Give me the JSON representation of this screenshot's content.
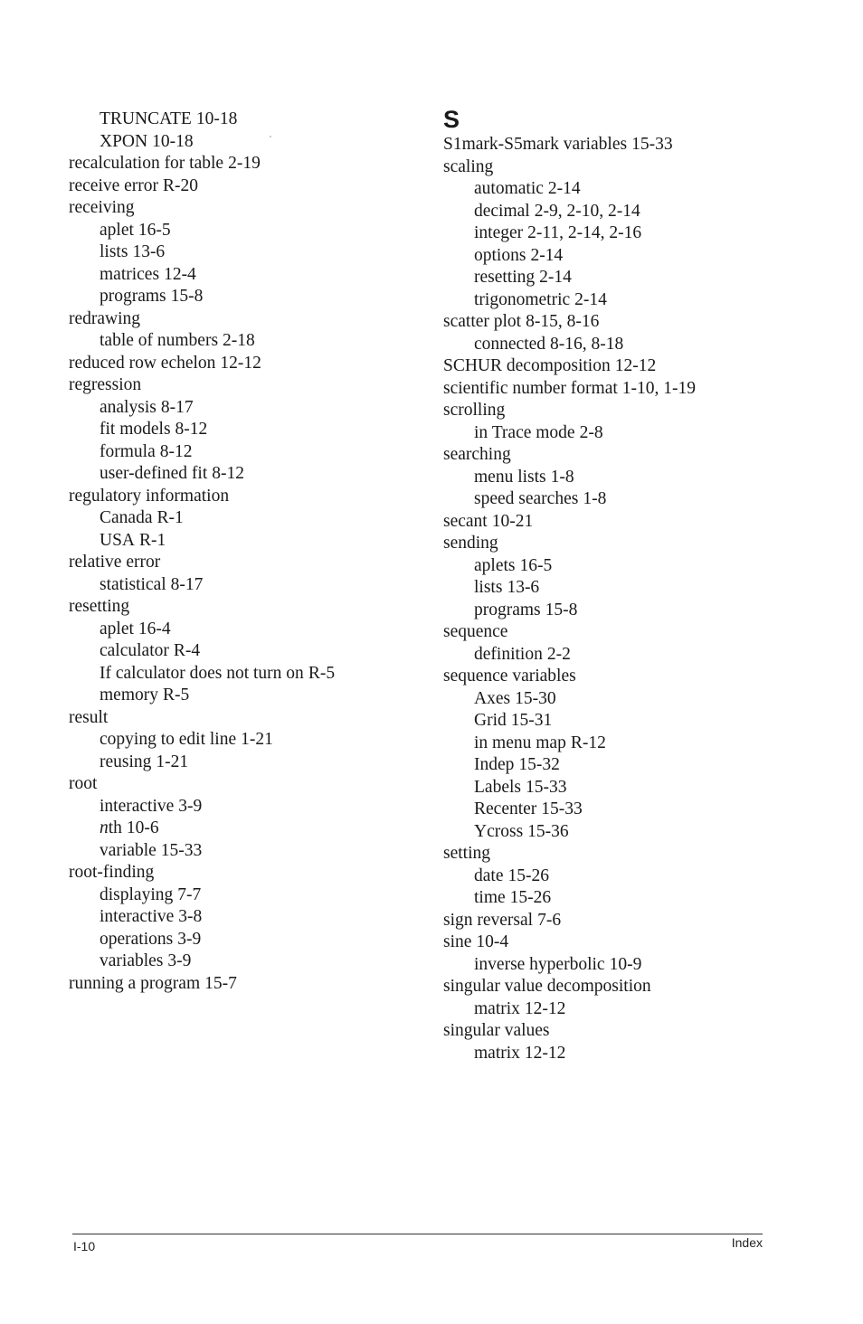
{
  "footer": {
    "page_number": "I-10",
    "section_name": "Index"
  },
  "left_column": {
    "entries": [
      {
        "level": "sub",
        "term": "TRUNCATE",
        "ref": "10-18"
      },
      {
        "level": "sub",
        "term": "XPON",
        "ref": "10-18"
      },
      {
        "level": "main",
        "term": "recalculation for table",
        "ref": "2-19"
      },
      {
        "level": "main",
        "term": "receive error",
        "ref": "R-20"
      },
      {
        "level": "main",
        "term": "receiving",
        "ref": ""
      },
      {
        "level": "sub",
        "term": "aplet",
        "ref": "16-5"
      },
      {
        "level": "sub",
        "term": "lists",
        "ref": "13-6"
      },
      {
        "level": "sub",
        "term": "matrices",
        "ref": "12-4"
      },
      {
        "level": "sub",
        "term": "programs",
        "ref": "15-8"
      },
      {
        "level": "main",
        "term": "redrawing",
        "ref": ""
      },
      {
        "level": "sub",
        "term": "table of numbers",
        "ref": "2-18"
      },
      {
        "level": "main",
        "term": "reduced row echelon",
        "ref": "12-12"
      },
      {
        "level": "main",
        "term": "regression",
        "ref": ""
      },
      {
        "level": "sub",
        "term": "analysis",
        "ref": "8-17"
      },
      {
        "level": "sub",
        "term": "fit models",
        "ref": "8-12"
      },
      {
        "level": "sub",
        "term": "formula",
        "ref": "8-12"
      },
      {
        "level": "sub",
        "term": "user-defined fit",
        "ref": "8-12"
      },
      {
        "level": "main",
        "term": "regulatory information",
        "ref": ""
      },
      {
        "level": "sub",
        "term": "Canada",
        "ref": "R-1"
      },
      {
        "level": "sub",
        "term": "USA",
        "ref": "R-1"
      },
      {
        "level": "main",
        "term": "relative error",
        "ref": ""
      },
      {
        "level": "sub",
        "term": "statistical",
        "ref": "8-17"
      },
      {
        "level": "main",
        "term": "resetting",
        "ref": ""
      },
      {
        "level": "sub",
        "term": "aplet",
        "ref": "16-4"
      },
      {
        "level": "sub",
        "term": "calculator",
        "ref": "R-4"
      },
      {
        "level": "sub",
        "term": "If calculator does not turn on",
        "ref": "R-5"
      },
      {
        "level": "sub",
        "term": "memory",
        "ref": "R-5"
      },
      {
        "level": "main",
        "term": "result",
        "ref": ""
      },
      {
        "level": "sub",
        "term": "copying to edit line",
        "ref": "1-21"
      },
      {
        "level": "sub",
        "term": "reusing",
        "ref": "1-21"
      },
      {
        "level": "main",
        "term": "root",
        "ref": ""
      },
      {
        "level": "sub",
        "term": "interactive",
        "ref": "3-9"
      },
      {
        "level": "sub",
        "term": "nth",
        "ref": "10-6",
        "italic_prefix": "n",
        "rest": "th"
      },
      {
        "level": "sub",
        "term": "variable",
        "ref": "15-33"
      },
      {
        "level": "main",
        "term": "root-finding",
        "ref": ""
      },
      {
        "level": "sub",
        "term": "displaying",
        "ref": "7-7"
      },
      {
        "level": "sub",
        "term": "interactive",
        "ref": "3-8"
      },
      {
        "level": "sub",
        "term": "operations",
        "ref": "3-9"
      },
      {
        "level": "sub",
        "term": "variables",
        "ref": "3-9"
      },
      {
        "level": "main",
        "term": "running a program",
        "ref": "15-7"
      }
    ]
  },
  "right_column": {
    "section_letter": "S",
    "entries": [
      {
        "level": "main",
        "term": "S1mark-S5mark variables",
        "ref": "15-33"
      },
      {
        "level": "main",
        "term": "scaling",
        "ref": ""
      },
      {
        "level": "sub",
        "term": "automatic",
        "ref": "2-14"
      },
      {
        "level": "sub",
        "term": "decimal",
        "ref": "2-9, 2-10, 2-14"
      },
      {
        "level": "sub",
        "term": "integer",
        "ref": "2-11, 2-14, 2-16"
      },
      {
        "level": "sub",
        "term": "options",
        "ref": "2-14"
      },
      {
        "level": "sub",
        "term": "resetting",
        "ref": "2-14"
      },
      {
        "level": "sub",
        "term": "trigonometric",
        "ref": "2-14"
      },
      {
        "level": "main",
        "term": "scatter plot",
        "ref": "8-15, 8-16"
      },
      {
        "level": "sub",
        "term": "connected",
        "ref": "8-16, 8-18"
      },
      {
        "level": "main",
        "term": "SCHUR decomposition",
        "ref": "12-12"
      },
      {
        "level": "main",
        "term": "scientific number format",
        "ref": "1-10, 1-19"
      },
      {
        "level": "main",
        "term": "scrolling",
        "ref": ""
      },
      {
        "level": "sub",
        "term": "in Trace mode",
        "ref": "2-8"
      },
      {
        "level": "main",
        "term": "searching",
        "ref": ""
      },
      {
        "level": "sub",
        "term": "menu lists",
        "ref": "1-8"
      },
      {
        "level": "sub",
        "term": "speed searches",
        "ref": "1-8"
      },
      {
        "level": "main",
        "term": "secant",
        "ref": "10-21"
      },
      {
        "level": "main",
        "term": "sending",
        "ref": ""
      },
      {
        "level": "sub",
        "term": "aplets",
        "ref": "16-5"
      },
      {
        "level": "sub",
        "term": "lists",
        "ref": "13-6"
      },
      {
        "level": "sub",
        "term": "programs",
        "ref": "15-8"
      },
      {
        "level": "main",
        "term": "sequence",
        "ref": ""
      },
      {
        "level": "sub",
        "term": "definition",
        "ref": "2-2"
      },
      {
        "level": "main",
        "term": "sequence variables",
        "ref": ""
      },
      {
        "level": "sub",
        "term": "Axes",
        "ref": "15-30"
      },
      {
        "level": "sub",
        "term": "Grid",
        "ref": "15-31"
      },
      {
        "level": "sub",
        "term": "in menu map",
        "ref": "R-12"
      },
      {
        "level": "sub",
        "term": "Indep",
        "ref": "15-32"
      },
      {
        "level": "sub",
        "term": "Labels",
        "ref": "15-33"
      },
      {
        "level": "sub",
        "term": "Recenter",
        "ref": "15-33"
      },
      {
        "level": "sub",
        "term": "Ycross",
        "ref": "15-36"
      },
      {
        "level": "main",
        "term": "setting",
        "ref": ""
      },
      {
        "level": "sub",
        "term": "date",
        "ref": "15-26"
      },
      {
        "level": "sub",
        "term": "time",
        "ref": "15-26"
      },
      {
        "level": "main",
        "term": "sign reversal",
        "ref": "7-6"
      },
      {
        "level": "main",
        "term": "sine",
        "ref": "10-4"
      },
      {
        "level": "sub",
        "term": "inverse hyperbolic",
        "ref": "10-9"
      },
      {
        "level": "main",
        "term": "singular value decomposition",
        "ref": ""
      },
      {
        "level": "sub",
        "term": "matrix",
        "ref": "12-12"
      },
      {
        "level": "main",
        "term": "singular values",
        "ref": ""
      },
      {
        "level": "sub",
        "term": "matrix",
        "ref": "12-12"
      }
    ]
  }
}
